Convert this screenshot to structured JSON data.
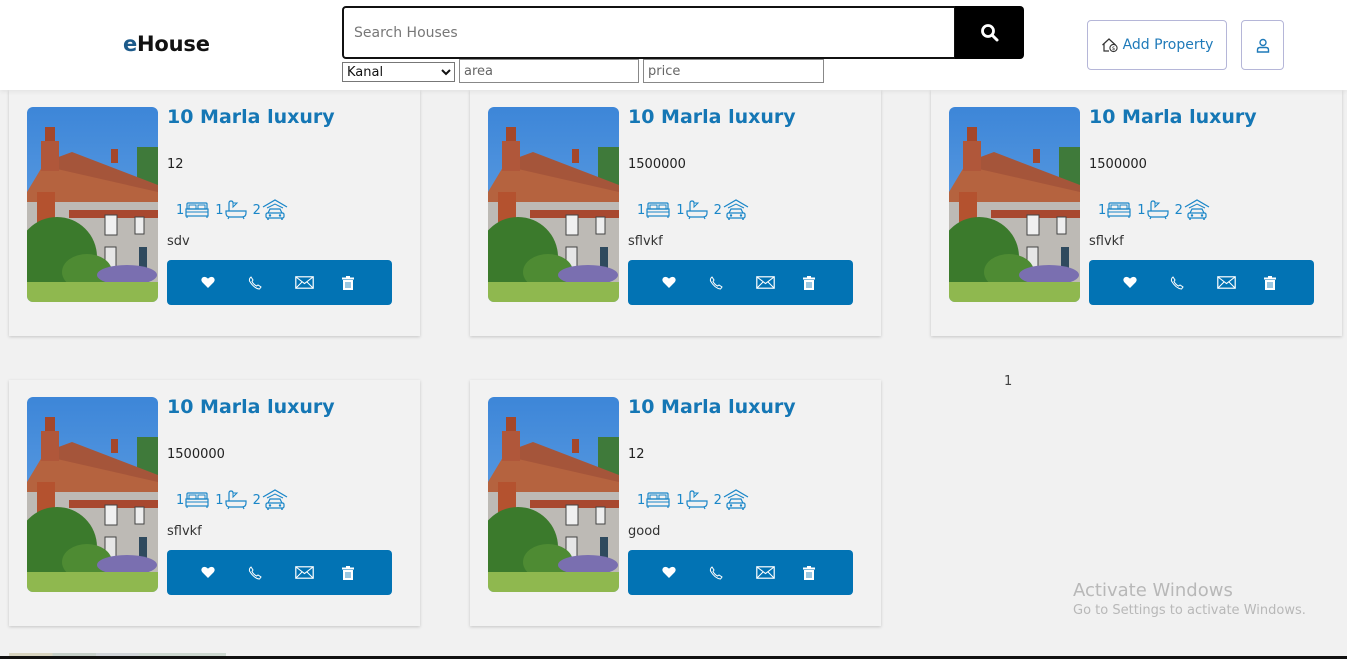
{
  "header": {
    "logo_accent": "e",
    "logo_rest": "House",
    "search_placeholder": "Search Houses",
    "search_value": "",
    "search_button_icon": "search-icon",
    "unit_select": {
      "selected": "Kanal",
      "options": [
        "Kanal"
      ]
    },
    "area_placeholder": "area",
    "price_placeholder": "price",
    "add_property_label": "Add Property",
    "add_property_icon": "house-dollar-icon",
    "profile_icon": "user-icon"
  },
  "listings": [
    {
      "title": "10 Marla luxury",
      "price": "12",
      "beds": "1",
      "baths": "1",
      "garages": "2",
      "description": "sdv"
    },
    {
      "title": "10 Marla luxury",
      "price": "1500000",
      "beds": "1",
      "baths": "1",
      "garages": "2",
      "description": "sflvkf"
    },
    {
      "title": "10 Marla luxury",
      "price": "1500000",
      "beds": "1",
      "baths": "1",
      "garages": "2",
      "description": "sflvkf"
    },
    {
      "title": "10 Marla luxury",
      "price": "1500000",
      "beds": "1",
      "baths": "1",
      "garages": "2",
      "description": "sflvkf"
    },
    {
      "title": "10 Marla luxury",
      "price": "12",
      "beds": "1",
      "baths": "1",
      "garages": "2",
      "description": "good"
    }
  ],
  "card_actions": [
    "heart-icon",
    "phone-icon",
    "envelope-icon",
    "trash-icon"
  ],
  "pagination": {
    "current_page": "1"
  },
  "watermark": {
    "title": "Activate Windows",
    "subtitle": "Go to Settings to activate Windows."
  },
  "colors": {
    "brand_blue": "#1577b5",
    "action_bar": "#0273b4",
    "logo_accent": "#1c5a8a",
    "search_button": "#000000"
  }
}
